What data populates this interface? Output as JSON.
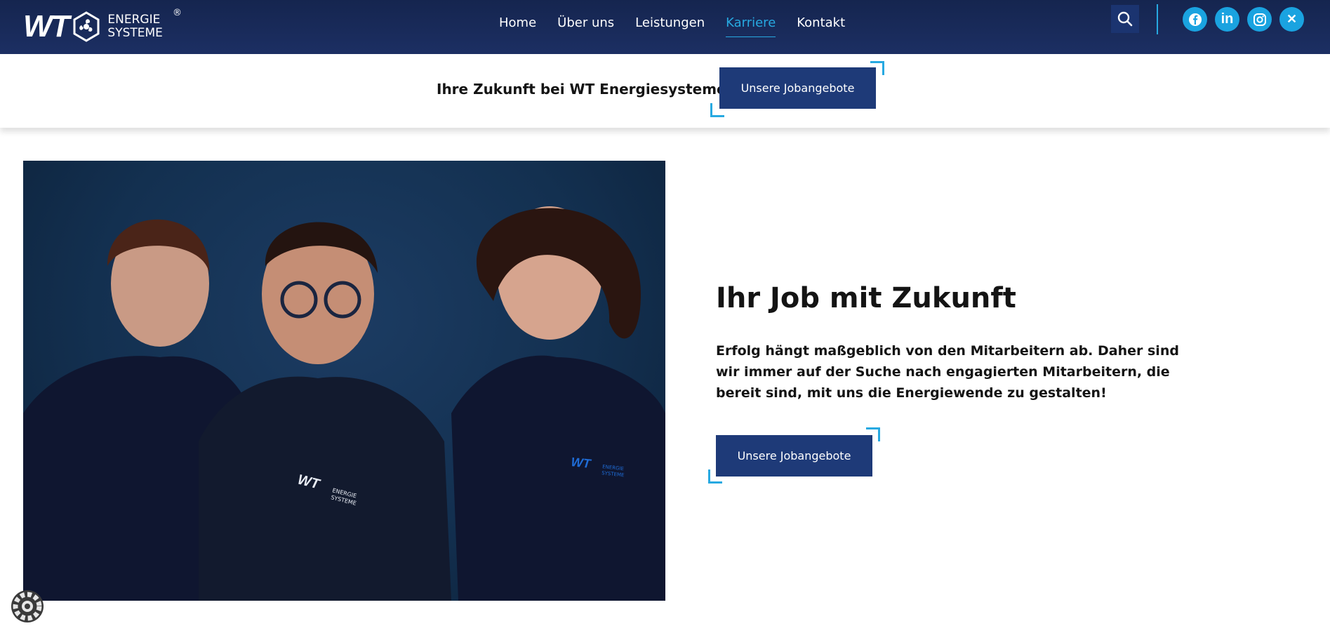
{
  "header": {
    "logo": {
      "wt": "WT",
      "line1": "ENERGIE",
      "line2": "SYSTEME",
      "reg": "®"
    },
    "nav": [
      {
        "label": "Home"
      },
      {
        "label": "Über uns"
      },
      {
        "label": "Leistungen"
      },
      {
        "label": "Karriere"
      },
      {
        "label": "Kontakt"
      }
    ],
    "active_nav": "Karriere",
    "search_icon": "search-icon",
    "social": [
      {
        "name": "facebook-icon",
        "glyph": "f"
      },
      {
        "name": "linkedin-icon",
        "glyph": "in"
      },
      {
        "name": "instagram-icon",
        "glyph": ""
      },
      {
        "name": "xing-icon",
        "glyph": "✕"
      }
    ]
  },
  "subbar": {
    "text": "Ihre Zukunft bei WT Energiesysteme",
    "button": "Unsere Jobangebote"
  },
  "main": {
    "photo_shirt_logo": {
      "wt": "WT",
      "line1": "ENERGIE",
      "line2": "SYSTEME"
    },
    "heading": "Ihr Job mit Zukunft",
    "paragraph": "Erfolg hängt maßgeblich von den Mitarbeitern ab. Daher sind wir immer auf der Suche nach engagierten Mitarbeitern, die bereit sind, mit uns die Energiewende zu gestalten!",
    "button": "Unsere Jobangebote"
  },
  "colors": {
    "header_bg": "#1c2f63",
    "accent": "#27a9e1",
    "button_bg": "#1e3a78"
  }
}
